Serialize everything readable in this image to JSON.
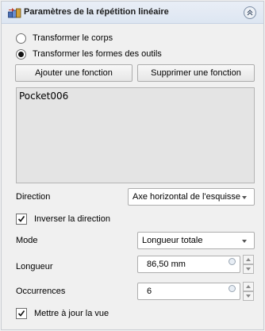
{
  "header": {
    "title": "Paramètres de la répétition linéaire",
    "icon": "linear-pattern-icon",
    "collapse_icon": "collapse-chevrons-icon"
  },
  "mode_radios": [
    {
      "label": "Transformer le corps",
      "checked": false
    },
    {
      "label": "Transformer les formes des outils",
      "checked": true
    }
  ],
  "buttons": {
    "add_feature": "Ajouter une fonction",
    "remove_feature": "Supprimer une fonction"
  },
  "features_list": [
    "Pocket006"
  ],
  "direction": {
    "label": "Direction",
    "value": "Axe horizontal de l'esquisse"
  },
  "reverse": {
    "label": "Inverser la direction",
    "checked": true
  },
  "mode": {
    "label": "Mode",
    "value": "Longueur totale"
  },
  "length": {
    "label": "Longueur",
    "value": "86,50 mm"
  },
  "occurrences": {
    "label": "Occurrences",
    "value": "6"
  },
  "update_view": {
    "label": "Mettre à jour la vue",
    "checked": true
  }
}
